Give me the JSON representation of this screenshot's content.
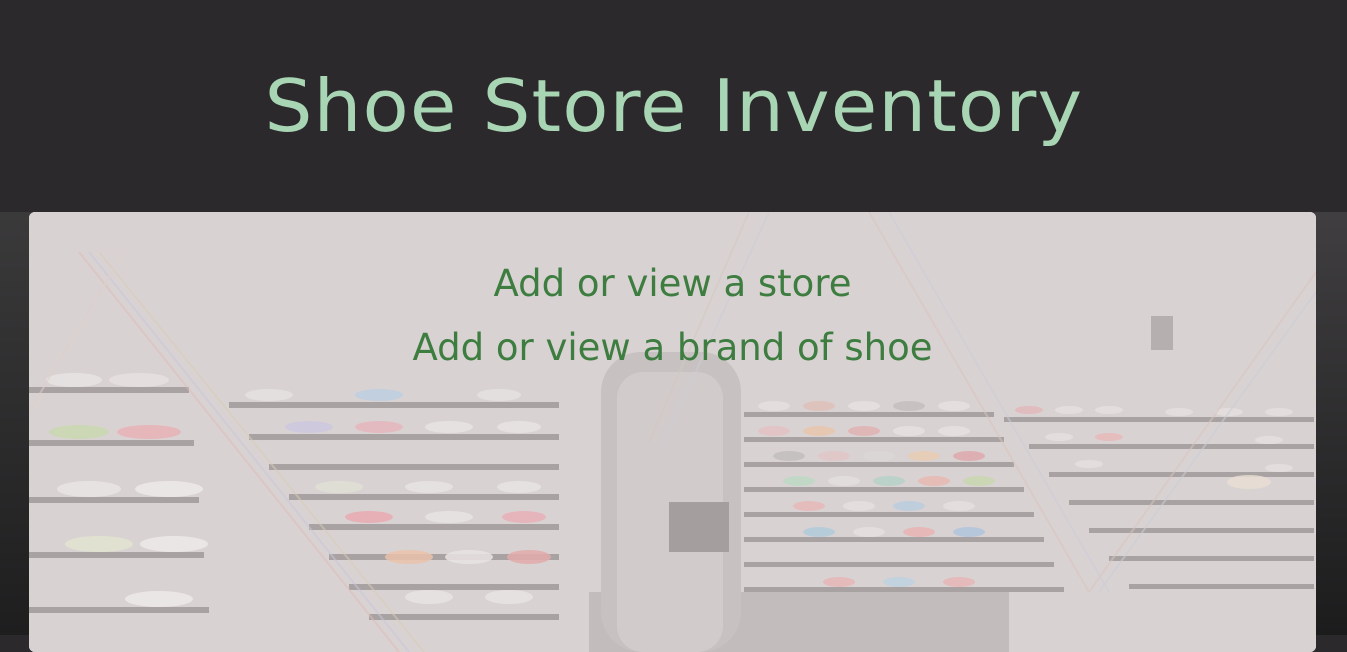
{
  "header": {
    "title": "Shoe Store Inventory"
  },
  "nav": {
    "stores_link": "Add or view a store",
    "brands_link": "Add or view a brand of shoe"
  },
  "background": {
    "image": "shoe-store-shelves"
  },
  "colors": {
    "header_bg": "#2b292b",
    "title": "#a8d5b3",
    "link": "#3e7d40",
    "panel": "#e4dcdc"
  }
}
